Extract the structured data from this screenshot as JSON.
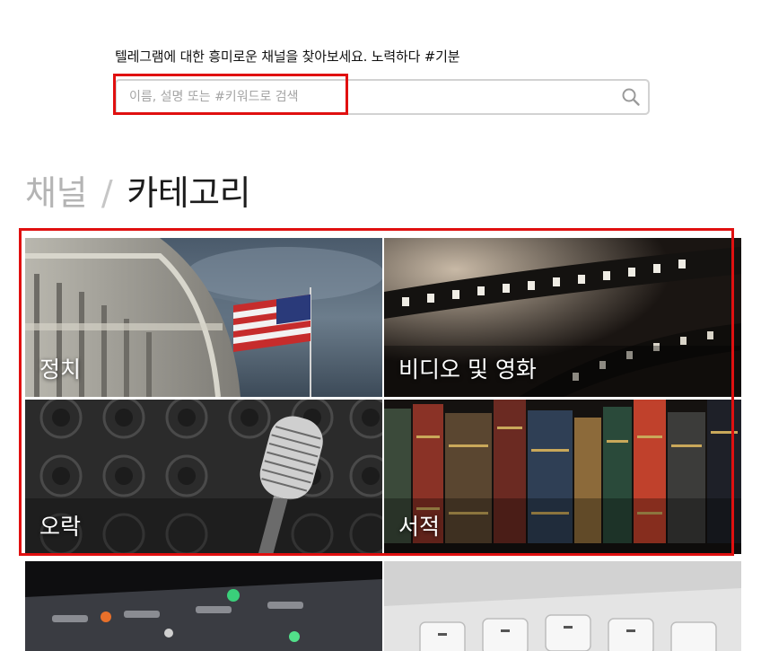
{
  "header": {
    "tagline": "텔레그램에 대한 흥미로운 채널을 찾아보세요. 노력하다 #기분"
  },
  "search": {
    "placeholder": "이름, 설명 또는 #키워드로 검색",
    "value": "",
    "icon": "search-icon"
  },
  "breadcrumb": {
    "parent": "채널",
    "separator": "/",
    "current": "카테고리"
  },
  "categories": [
    {
      "label": "정치",
      "image": "capitol-flag-image"
    },
    {
      "label": "비디오 및 영화",
      "image": "film-reel-image"
    },
    {
      "label": "오락",
      "image": "microphone-speakers-image"
    },
    {
      "label": "서적",
      "image": "old-books-image"
    },
    {
      "label": "",
      "image": "mixing-console-image"
    },
    {
      "label": "",
      "image": "keyboard-keys-image"
    }
  ],
  "colors": {
    "highlight": "#e01010",
    "breadcrumb_parent": "#b4b4b4",
    "breadcrumb_current": "#1c1c1c"
  }
}
